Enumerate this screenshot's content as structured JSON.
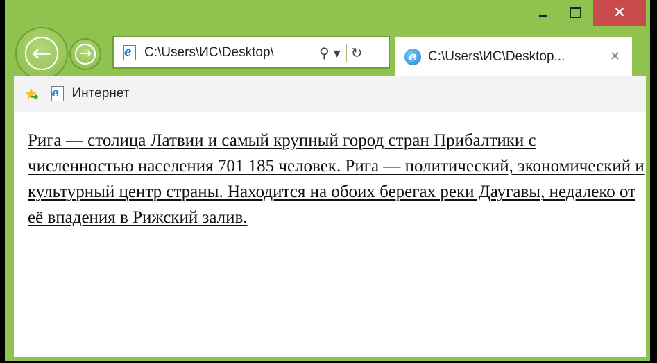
{
  "window": {
    "close_glyph": "✕",
    "colors": {
      "frame": "#8fc24e",
      "close_button": "#c94b4b",
      "content_background": "#ffffff"
    }
  },
  "navigation": {
    "back_icon": "arrow-left-icon",
    "forward_icon": "arrow-right-icon",
    "back_glyph": "←",
    "forward_glyph": "→"
  },
  "address_bar": {
    "url": "C:\\Users\\ИС\\Desktop\\",
    "search_glyph": "⚲",
    "dropdown_glyph": "▾",
    "refresh_glyph": "↻"
  },
  "tab": {
    "title": "C:\\Users\\ИС\\Desktop...",
    "close_glyph": "✕"
  },
  "favorites_bar": {
    "star_glyph": "★",
    "add_glyph": "➜",
    "label": "Интернет"
  },
  "content": {
    "text": "Рига — столица Латвии и самый крупный город стран Прибалтики с численностью населения 701 185 человек. Рига — политический, экономический и культурный центр страны. Находится на обоих берегах реки Даугавы, недалеко от её впадения в Рижский залив."
  }
}
